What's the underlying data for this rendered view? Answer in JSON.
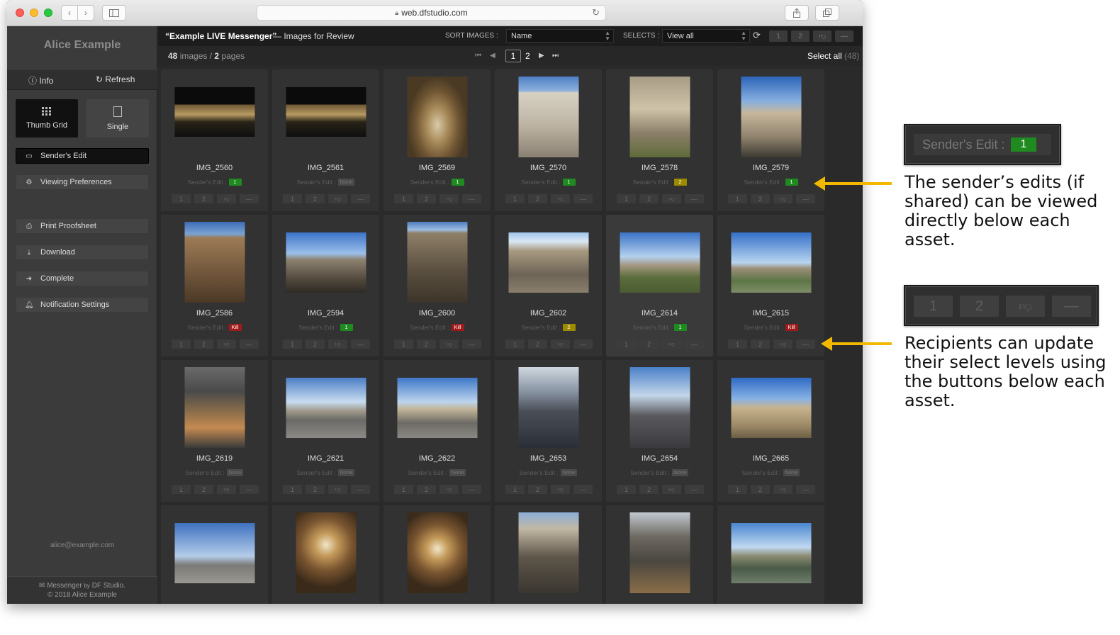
{
  "browser": {
    "url": "web.dfstudio.com",
    "back": "‹",
    "forward": "›",
    "new_tab": "+"
  },
  "sidebar": {
    "brand": "Alice Example",
    "info": "Info",
    "refresh": "Refresh",
    "thumb_grid": "Thumb Grid",
    "single": "Single",
    "senders_edit": "Sender's Edit",
    "viewing_preferences": "Viewing Preferences",
    "print_proofsheet": "Print Proofsheet",
    "download": "Download",
    "complete": "Complete",
    "notification_settings": "Notification Settings",
    "email": "alice@example.com",
    "footer_line1_a": "Messenger",
    "footer_line1_b": "by",
    "footer_line1_c": "DF Studio.",
    "footer_line2": "© 2018 Alice Example"
  },
  "topbar": {
    "title": "“Example LIVE Messenger”",
    "subtitle": "— Images for Review",
    "sort_label": "SORT IMAGES :",
    "sort_value": "Name",
    "selects_label": "SELECTS :",
    "selects_value": "View all",
    "sel_btn_1": "1",
    "sel_btn_2": "2",
    "sel_btn_dash": "—"
  },
  "pagebar": {
    "count": "48",
    "count_label": "images /",
    "pages": "2",
    "pages_label": "pages",
    "page1": "1",
    "page2": "2",
    "select_all": "Select all",
    "select_all_count": "(48)"
  },
  "senders_edit_label": "Sender's Edit :",
  "select_buttons": [
    "1",
    "2",
    "",
    "—"
  ],
  "colors": {
    "green": "#1f8a1f",
    "yellow": "#9c8a00",
    "red": "#a01a1a",
    "none": "#4a4a4a",
    "accent_arrow": "#f2b800"
  },
  "images": [
    {
      "name": "IMG_2560",
      "edit": "1",
      "edit_type": "green"
    },
    {
      "name": "IMG_2561",
      "edit": "None",
      "edit_type": "none"
    },
    {
      "name": "IMG_2569",
      "edit": "1",
      "edit_type": "green"
    },
    {
      "name": "IMG_2570",
      "edit": "1",
      "edit_type": "green"
    },
    {
      "name": "IMG_2578",
      "edit": "2",
      "edit_type": "yellow"
    },
    {
      "name": "IMG_2579",
      "edit": "1",
      "edit_type": "green"
    },
    {
      "name": "IMG_2586",
      "edit": "Kill",
      "edit_type": "red"
    },
    {
      "name": "IMG_2594",
      "edit": "1",
      "edit_type": "green"
    },
    {
      "name": "IMG_2600",
      "edit": "Kill",
      "edit_type": "red"
    },
    {
      "name": "IMG_2602",
      "edit": "2",
      "edit_type": "yellow"
    },
    {
      "name": "IMG_2614",
      "edit": "1",
      "edit_type": "green"
    },
    {
      "name": "IMG_2615",
      "edit": "Kill",
      "edit_type": "red"
    },
    {
      "name": "IMG_2619",
      "edit": "None",
      "edit_type": "none"
    },
    {
      "name": "IMG_2621",
      "edit": "None",
      "edit_type": "none"
    },
    {
      "name": "IMG_2622",
      "edit": "None",
      "edit_type": "none"
    },
    {
      "name": "IMG_2653",
      "edit": "None",
      "edit_type": "none"
    },
    {
      "name": "IMG_2654",
      "edit": "None",
      "edit_type": "none"
    },
    {
      "name": "IMG_2665",
      "edit": "None",
      "edit_type": "none"
    },
    {
      "name": "",
      "edit": "",
      "edit_type": "none"
    },
    {
      "name": "",
      "edit": "",
      "edit_type": "none"
    },
    {
      "name": "",
      "edit": "",
      "edit_type": "none"
    },
    {
      "name": "",
      "edit": "",
      "edit_type": "none"
    },
    {
      "name": "",
      "edit": "",
      "edit_type": "none"
    },
    {
      "name": "",
      "edit": "",
      "edit_type": "none"
    }
  ],
  "annotations": {
    "callout1_label": "Sender's Edit :",
    "callout1_value": "1",
    "callout1_text": "The sender’s edits (if shared) can be viewed directly below each asset.",
    "callout2_buttons": [
      "1",
      "2",
      "",
      "—"
    ],
    "callout2_text": "Recipients can update their select levels using the buttons below each asset."
  }
}
